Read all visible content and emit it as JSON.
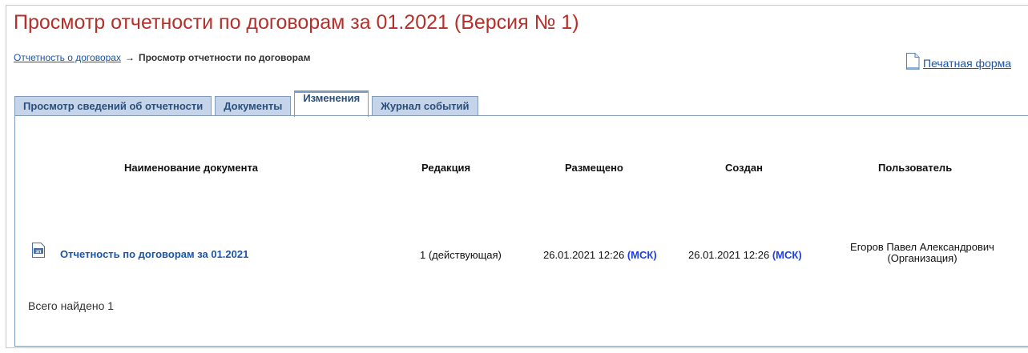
{
  "page": {
    "title": "Просмотр отчетности по договорам за 01.2021 (Версия № 1)"
  },
  "breadcrumb": {
    "link_label": "Отчетность о договорах",
    "arrow": "→",
    "current": "Просмотр отчетности по договорам"
  },
  "print_form": {
    "label": "Печатная форма",
    "icon": "document-icon"
  },
  "tabs": [
    {
      "label": "Просмотр сведений об отчетности",
      "active": false
    },
    {
      "label": "Документы",
      "active": false
    },
    {
      "label": "Изменения",
      "active": true
    },
    {
      "label": "Журнал событий",
      "active": false
    }
  ],
  "table": {
    "headers": {
      "name": "Наименование документа",
      "revision": "Редакция",
      "placed": "Размещено",
      "created": "Создан",
      "user": "Пользователь"
    },
    "rows": [
      {
        "icon": "file-text-icon",
        "icon_label": "зп",
        "name": "Отчетность по договорам за 01.2021",
        "revision": "1 (действующая)",
        "placed_date": "26.01.2021 12:26",
        "placed_tz": "(МСК)",
        "created_date": "26.01.2021 12:26",
        "created_tz": "(МСК)",
        "user_line1": "Егоров Павел Александрович",
        "user_line2": "(Организация)"
      }
    ]
  },
  "footer": {
    "total": "Всего найдено 1"
  },
  "colors": {
    "title": "#b5302a",
    "link": "#1a56a6",
    "tab_bg": "#c5d4e8",
    "tab_border": "#7f9db9",
    "timezone": "#1f3fe0"
  }
}
